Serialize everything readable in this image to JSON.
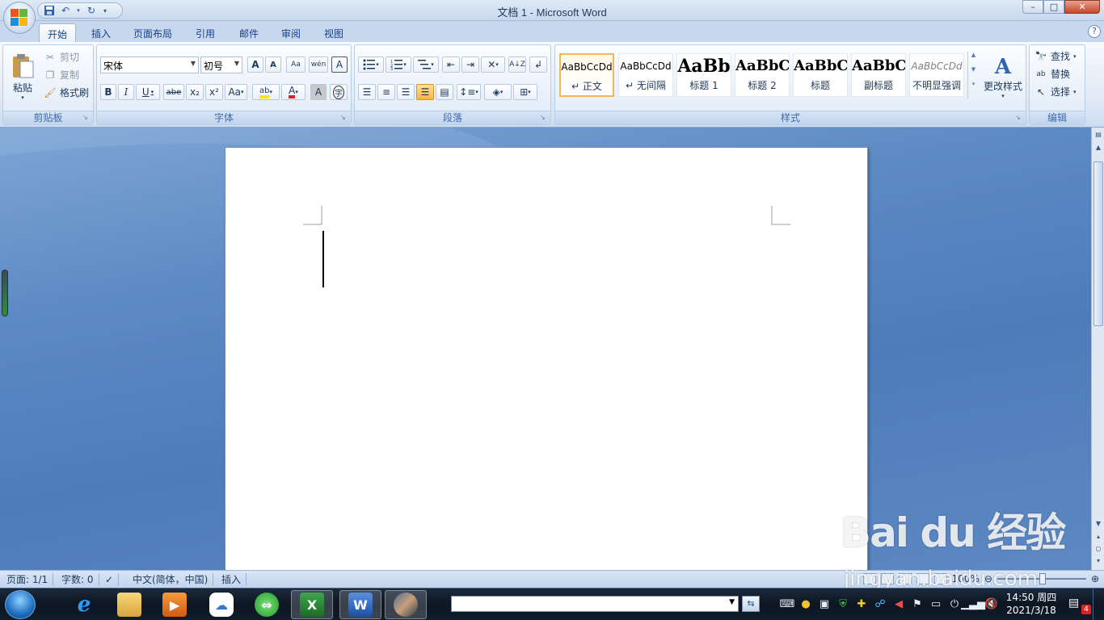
{
  "window": {
    "title": "文档 1 - Microsoft Word",
    "controls": {
      "minimize": "–",
      "maximize": "□",
      "close": "✕"
    }
  },
  "tabs": [
    {
      "label": "开始",
      "active": true
    },
    {
      "label": "插入"
    },
    {
      "label": "页面布局"
    },
    {
      "label": "引用"
    },
    {
      "label": "邮件"
    },
    {
      "label": "审阅"
    },
    {
      "label": "视图"
    }
  ],
  "help": "?",
  "clipboard": {
    "group_label": "剪贴板",
    "paste": "粘贴",
    "cut": "剪切",
    "copy": "复制",
    "format_painter": "格式刷"
  },
  "font": {
    "group_label": "字体",
    "font_name": "宋体",
    "font_size": "初号",
    "grow": "A",
    "shrink": "A",
    "clear": "Aa",
    "phonetic": "wén",
    "border": "A",
    "bold": "B",
    "italic": "I",
    "underline": "U",
    "strike": "abe",
    "subscript": "x₂",
    "superscript": "x²",
    "change_case": "Aa",
    "highlight": "ab",
    "color": "A",
    "shading": "A",
    "enclose": "字"
  },
  "paragraph": {
    "group_label": "段落"
  },
  "styles": {
    "group_label": "样式",
    "items": [
      {
        "sample": "AaBbCcDd",
        "name": "↵ 正文",
        "selected": true
      },
      {
        "sample": "AaBbCcDd",
        "name": "↵ 无间隔"
      },
      {
        "sample": "AaBb",
        "name": "标题 1"
      },
      {
        "sample": "AaBbC",
        "name": "标题 2"
      },
      {
        "sample": "AaBbC",
        "name": "标题"
      },
      {
        "sample": "AaBbC",
        "name": "副标题"
      },
      {
        "sample": "AaBbCcDd",
        "name": "不明显强调"
      }
    ],
    "change_styles": "更改样式"
  },
  "editing": {
    "group_label": "编辑",
    "find": "查找",
    "replace": "替换",
    "select": "选择"
  },
  "status": {
    "page": "页面: 1/1",
    "words": "字数: 0",
    "language": "中文(简体，中国)",
    "mode": "插入",
    "zoom": "100%"
  },
  "watermark": {
    "logo": "Bai du 经验",
    "url": "jingyan.baidu.com"
  },
  "taskbar": {
    "clock_time": "14:50 周四",
    "clock_date": "2021/3/18",
    "notification_count": "4"
  }
}
